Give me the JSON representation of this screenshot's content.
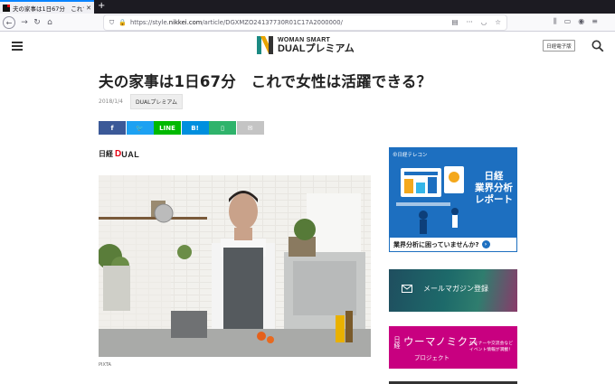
{
  "browser": {
    "tab_title": "夫の家事は1日67分　これで女性は",
    "url_prefix": "https://style.",
    "url_domain": "nikkei.com",
    "url_path": "/article/DGXMZO24137730R01C17A2000000/"
  },
  "site": {
    "logo_line1": "WOMAN SMART",
    "logo_line2": "DUALプレミアム",
    "digital_edition": "日経電子版"
  },
  "article": {
    "title": "夫の家事は1日67分　これで女性は活躍できる？",
    "date": "2018/1/4",
    "tag": "DUALプレミアム",
    "brand_nikkei": "日経",
    "brand_d": "D",
    "brand_ual": "UAL",
    "photo_credit": "PIXTA"
  },
  "share": [
    {
      "label": "f",
      "color": "#3b5998",
      "name": "share-facebook-button"
    },
    {
      "label": "🐦",
      "color": "#1da1f2",
      "name": "share-twitter-button"
    },
    {
      "label": "LINE",
      "color": "#00b900",
      "name": "share-line-button"
    },
    {
      "label": "B!",
      "color": "#008fde",
      "name": "share-hatena-button"
    },
    {
      "label": "▯",
      "color": "#2fb36b",
      "name": "share-pocket-button"
    },
    {
      "label": "✉",
      "color": "#c4c4c4",
      "name": "share-mail-button"
    }
  ],
  "sidebar": {
    "ad1_head": "⊕日経テレコン",
    "ad1_title": "日経\n業界分析\nレポート",
    "ad1_foot": "業界分析に困っていませんか?",
    "ad2_label": "メールマガジン登録",
    "ad3_nikkei": "日経",
    "ad3_title": "ウーマノミクス",
    "ad3_sub": "プロジェクト",
    "ad3_note1": "セミナーや交流会など",
    "ad3_note2": "イベント情報が満載！"
  }
}
